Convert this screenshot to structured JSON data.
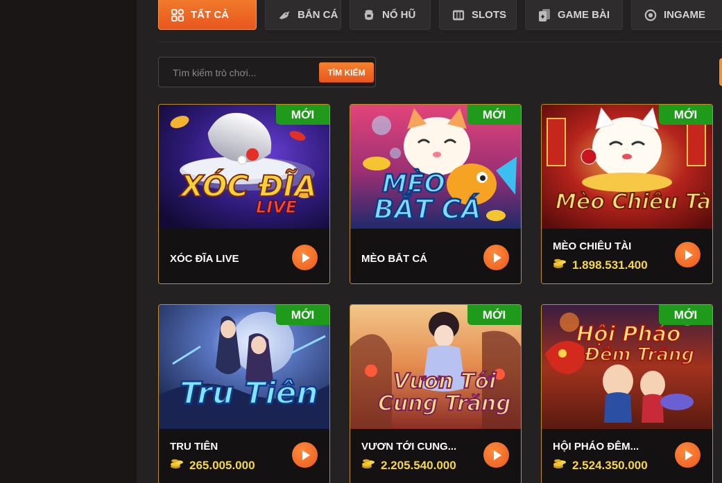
{
  "tabs": [
    {
      "label": "TẤT CẢ",
      "icon": "grid-icon",
      "active": true
    },
    {
      "label": "BẮN CÁ",
      "icon": "fish-icon",
      "active": false
    },
    {
      "label": "NỔ HŨ",
      "icon": "jar-icon",
      "active": false
    },
    {
      "label": "SLOTS",
      "icon": "slots-icon",
      "active": false
    },
    {
      "label": "GAME BÀI",
      "icon": "cards-icon",
      "active": false
    },
    {
      "label": "INGAME",
      "icon": "ingame-icon",
      "active": false
    }
  ],
  "search": {
    "placeholder": "Tìm kiếm trò chơi...",
    "button_label": "TÌM KIẾM"
  },
  "badge_label": "MỚI",
  "games": [
    {
      "name": "XÓC ĐĨA LIVE",
      "jackpot": "",
      "art_text": "XÓC ĐĨA",
      "art_sub": "LIVE"
    },
    {
      "name": "MÈO BẮT CÁ",
      "jackpot": "",
      "art_text": "MÈO",
      "art_sub": "BẮT CÁ"
    },
    {
      "name": "MÈO CHIÊU TÀI",
      "jackpot": "1.898.531.400",
      "art_text": "Mèo Chiêu Tài",
      "art_sub": ""
    },
    {
      "name": "TRU TIÊN",
      "jackpot": "265.005.000",
      "art_text": "Tru Tiên",
      "art_sub": ""
    },
    {
      "name": "VƯƠN TỚI CUNG...",
      "jackpot": "2.205.540.000",
      "art_text": "Vươn Tới",
      "art_sub": "Cung Trăng"
    },
    {
      "name": "HỘI PHÁO ĐÊM...",
      "jackpot": "2.524.350.000",
      "art_text": "Hội Pháo",
      "art_sub": "Đêm Trăng"
    }
  ],
  "colors": {
    "accent": "#ee6a24",
    "badge": "#1f9a1b",
    "jackpot": "#f7d74a",
    "card_border": "#c18f2a"
  }
}
